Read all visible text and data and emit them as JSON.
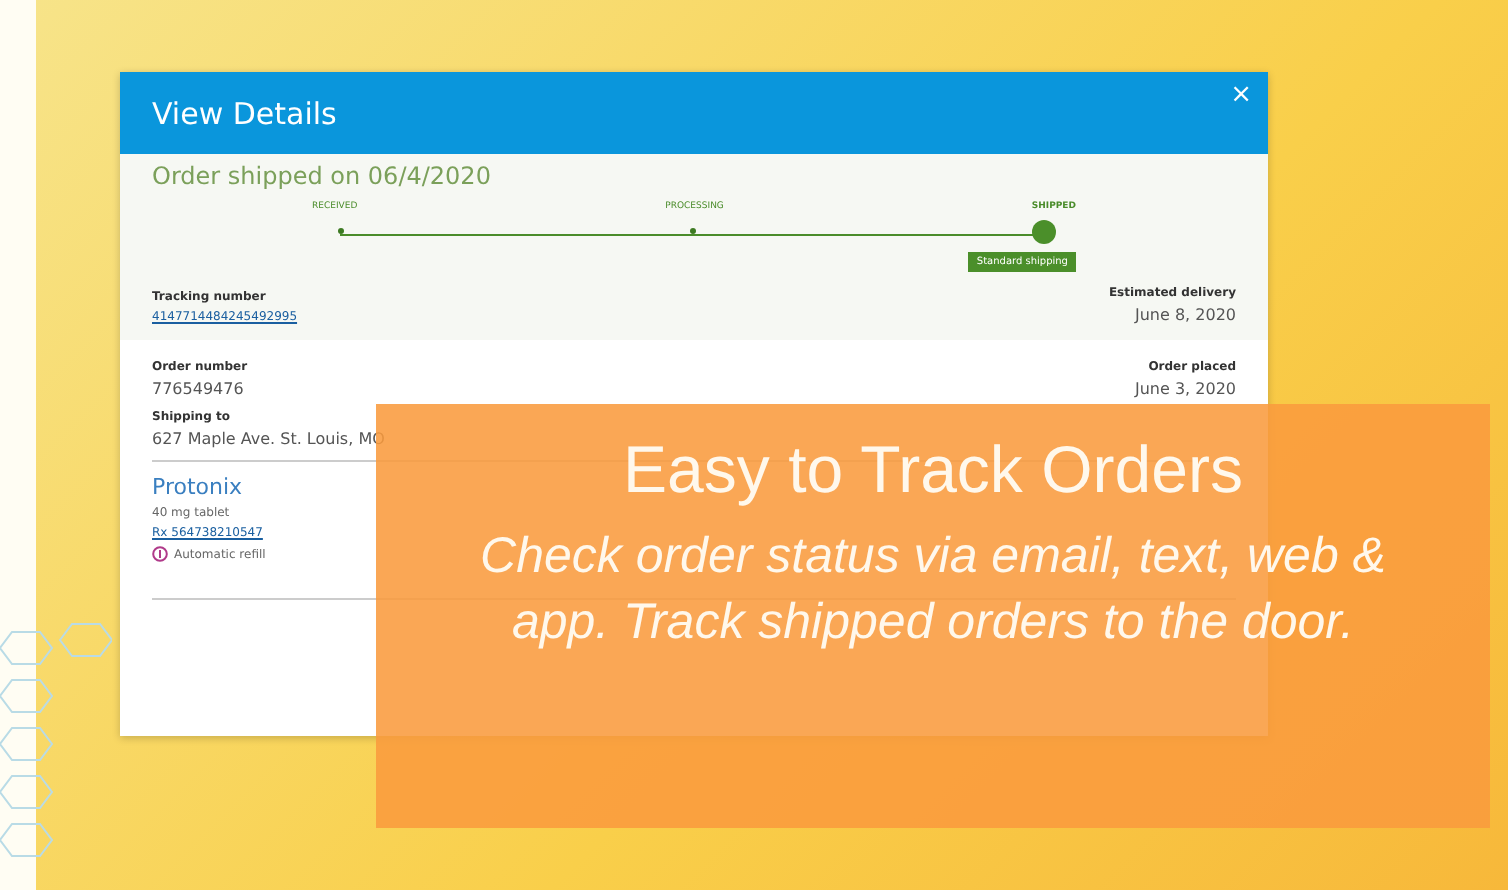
{
  "dialog": {
    "title": "View Details",
    "close": "×",
    "status": "Order shipped on 06/4/2020",
    "steps": [
      {
        "label": "RECEIVED",
        "selected": false
      },
      {
        "label": "PROCESSING",
        "selected": false
      },
      {
        "label": "SHIPPED",
        "selected": true
      }
    ],
    "step_badge": "Standard shipping",
    "tracking": {
      "label": "Tracking number",
      "value": "4147714484245492995"
    },
    "delivery": {
      "label": "Estimated delivery",
      "value": "June 8, 2020"
    },
    "order_number": {
      "label": "Order number",
      "value": "776549476"
    },
    "order_placed": {
      "label": "Order placed",
      "value": "June 3, 2020"
    },
    "shipping_to": {
      "label": "Shipping to",
      "value": "627 Maple Ave. St. Louis, MO"
    },
    "item": {
      "name": "Protonix",
      "detail": "40 mg tablet",
      "rx": "Rx 564738210547",
      "refill": "Automatic refill"
    }
  },
  "callout": {
    "title": "Easy to Track Orders",
    "text": "Check order status via email, text, web & app. Track shipped orders to the door."
  }
}
